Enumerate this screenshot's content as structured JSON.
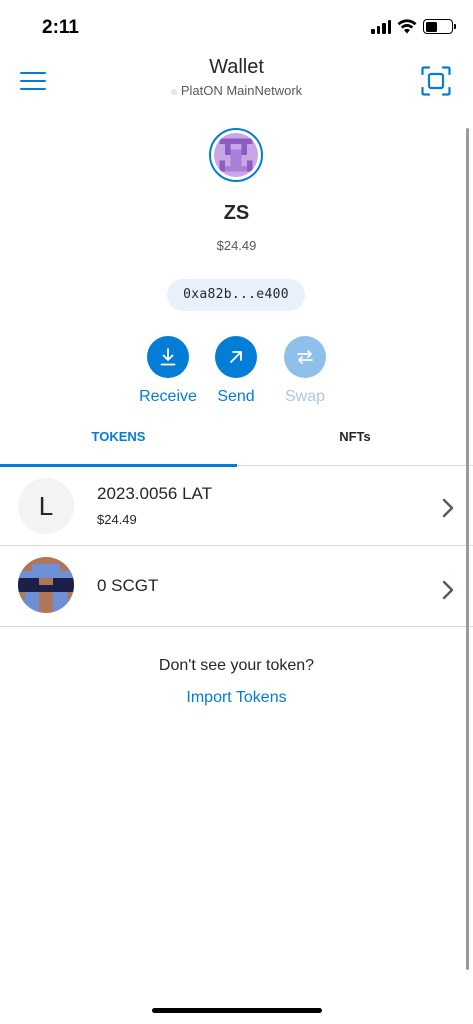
{
  "status_bar": {
    "time": "2:11"
  },
  "header": {
    "title": "Wallet",
    "network": "PlatON MainNetwork"
  },
  "account": {
    "name": "ZS",
    "balance": "$24.49",
    "address": "0xa82b...e400"
  },
  "actions": [
    {
      "label": "Receive",
      "icon": "download-icon",
      "enabled": true
    },
    {
      "label": "Send",
      "icon": "arrow-up-right-icon",
      "enabled": true
    },
    {
      "label": "Swap",
      "icon": "swap-icon",
      "enabled": false
    }
  ],
  "tabs": [
    {
      "label": "TOKENS",
      "active": true
    },
    {
      "label": "NFTs",
      "active": false
    }
  ],
  "tokens": [
    {
      "avatar_letter": "L",
      "amount": "2023.0056 LAT",
      "fiat": "$24.49"
    },
    {
      "avatar_letter": "",
      "amount": "0 SCGT",
      "fiat": ""
    }
  ],
  "footer": {
    "no_token_text": "Don't see your token?",
    "import_link": "Import Tokens"
  },
  "colors": {
    "accent": "#037dd6",
    "accent_disabled": "#8fc0ea",
    "address_bg": "#e8f1fb",
    "divider": "#d6d9dc"
  }
}
